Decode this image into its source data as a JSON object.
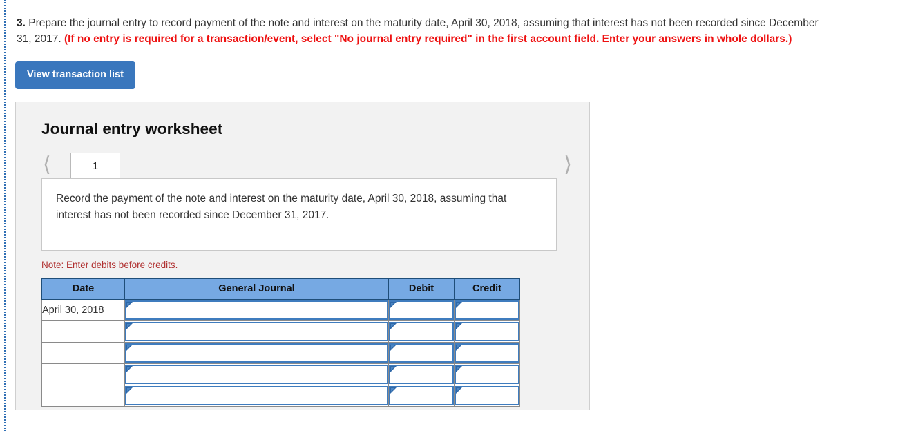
{
  "question": {
    "number": "3.",
    "text_part1": " Prepare the journal entry to record payment of the note and interest on the maturity date, April 30, 2018, assuming that interest has not been recorded since December 31, 2017. ",
    "text_red": "(If no entry is required for a transaction/event, select \"No journal entry required\" in the first account field. Enter your answers in whole dollars.)"
  },
  "toolbar": {
    "view_transaction_list_label": "View transaction list"
  },
  "worksheet": {
    "title": "Journal entry worksheet",
    "prev_icon": "chevron-left-icon",
    "next_icon": "chevron-right-icon",
    "tabs": [
      {
        "label": "1",
        "active": true
      }
    ],
    "instruction": "Record the payment of the note and interest on the maturity date, April 30, 2018, assuming that interest has not been recorded since December 31, 2017.",
    "note": "Note: Enter debits before credits.",
    "table": {
      "columns": [
        "Date",
        "General Journal",
        "Debit",
        "Credit"
      ],
      "rows": [
        {
          "date": "April 30, 2018",
          "general_journal": "",
          "debit": "",
          "credit": ""
        },
        {
          "date": "",
          "general_journal": "",
          "debit": "",
          "credit": ""
        },
        {
          "date": "",
          "general_journal": "",
          "debit": "",
          "credit": ""
        },
        {
          "date": "",
          "general_journal": "",
          "debit": "",
          "credit": ""
        },
        {
          "date": "",
          "general_journal": "",
          "debit": "",
          "credit": ""
        }
      ]
    }
  },
  "colors": {
    "button_blue": "#3a77bd",
    "header_blue": "#76a9e3",
    "cell_border_blue": "#3f7cbe",
    "red_text": "#ee1111",
    "note_red": "#b03030",
    "panel_gray": "#f2f2f2"
  }
}
